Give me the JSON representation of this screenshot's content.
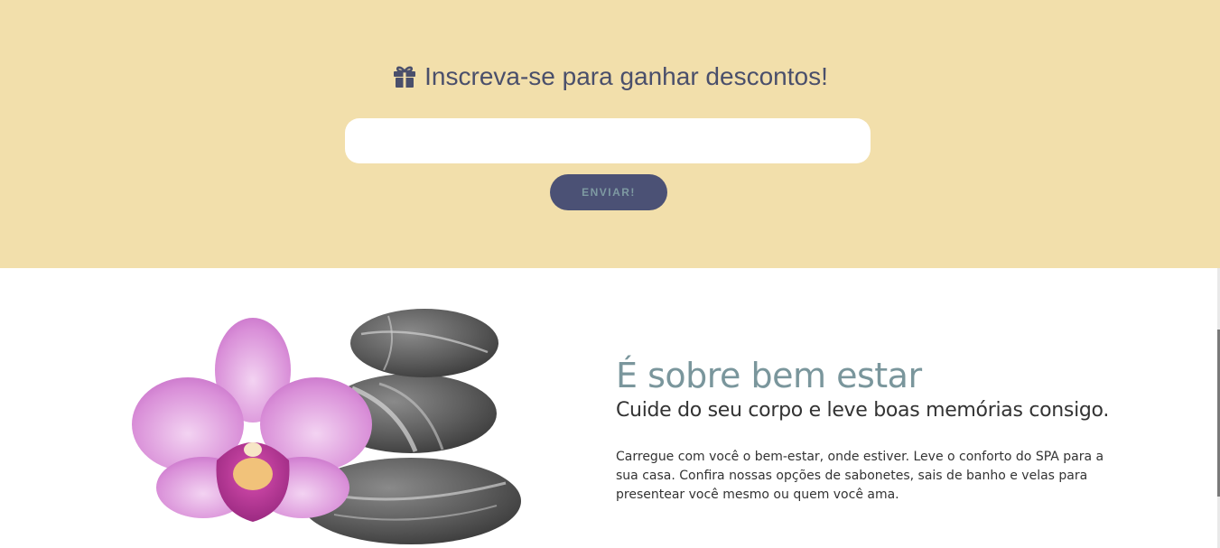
{
  "newsletter": {
    "icon": "gift-icon",
    "title": "Inscreva-se para ganhar descontos!",
    "email_value": "",
    "button_label": "ENVIAR!",
    "background_color": "#f2dfab",
    "button_color": "#4b5175"
  },
  "about": {
    "title": "É sobre bem estar",
    "subtitle": "Cuide do seu corpo e leve boas memórias consigo.",
    "text": "Carregue com você o bem-estar, onde estiver. Leve o conforto do SPA para a sua casa. Confira nossas opções de sabonetes, sais de banho e velas para presentear você mesmo ou quem você ama.",
    "image": "orchid-and-stones",
    "title_color": "#7a969c"
  }
}
